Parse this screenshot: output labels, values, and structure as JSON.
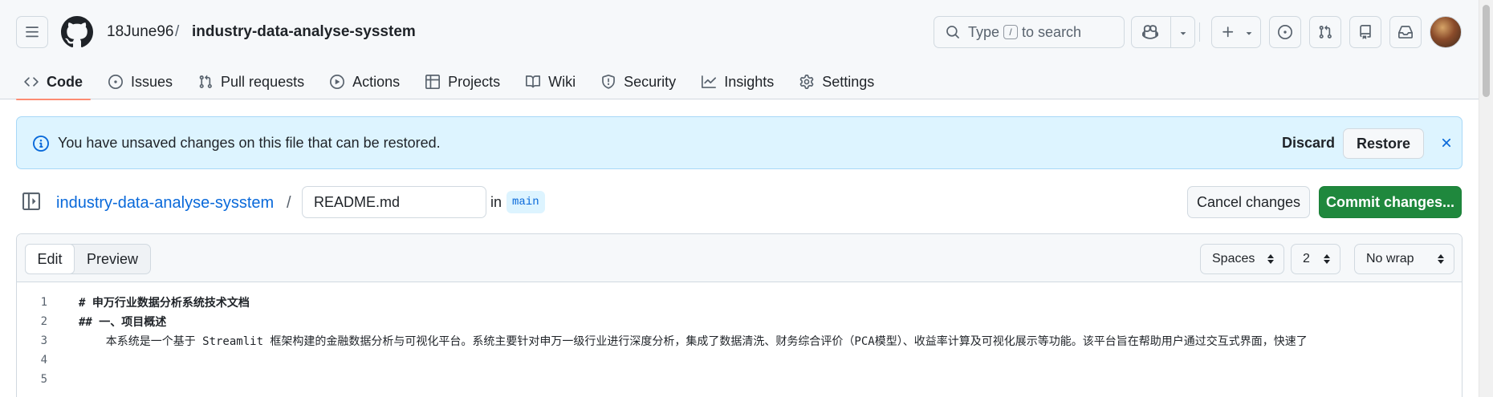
{
  "header": {
    "owner": "18June96",
    "separator": "/",
    "repo": "industry-data-analyse-sysstem",
    "search": {
      "before": "Type",
      "key": "/",
      "after": "to search"
    }
  },
  "nav": {
    "tabs": [
      {
        "label": "Code",
        "icon": "code-icon",
        "active": true
      },
      {
        "label": "Issues",
        "icon": "issue-icon"
      },
      {
        "label": "Pull requests",
        "icon": "pull-request-icon"
      },
      {
        "label": "Actions",
        "icon": "play-icon"
      },
      {
        "label": "Projects",
        "icon": "table-icon"
      },
      {
        "label": "Wiki",
        "icon": "book-icon"
      },
      {
        "label": "Security",
        "icon": "shield-icon"
      },
      {
        "label": "Insights",
        "icon": "graph-icon"
      },
      {
        "label": "Settings",
        "icon": "gear-icon"
      }
    ]
  },
  "flash": {
    "message": "You have unsaved changes on this file that can be restored.",
    "discard": "Discard",
    "restore": "Restore"
  },
  "file": {
    "repo": "industry-data-analyse-sysstem",
    "separator": "/",
    "name": "README.md",
    "in_label": "in",
    "branch": "main",
    "cancel": "Cancel changes",
    "commit": "Commit changes..."
  },
  "editor": {
    "edit_tab": "Edit",
    "preview_tab": "Preview",
    "indent_mode": "Spaces",
    "indent_size": "2",
    "wrap_mode": "No wrap",
    "lines": [
      {
        "n": "1",
        "text": "# 申万行业数据分析系统技术文档"
      },
      {
        "n": "2",
        "text": "## 一、项目概述"
      },
      {
        "n": "3",
        "text": "    本系统是一个基于 Streamlit 框架构建的金融数据分析与可视化平台。系统主要针对申万一级行业进行深度分析，集成了数据清洗、财务综合评价（PCA模型）、收益率计算及可视化展示等功能。该平台旨在帮助用户通过交互式界面，快速了"
      },
      {
        "n": "4",
        "text": ""
      },
      {
        "n": "5",
        "text": ""
      }
    ]
  },
  "colors": {
    "accent_blue": "#0969da",
    "commit_green": "#1f883d",
    "flash_bg": "#ddf4ff",
    "active_tab_underline": "#fd8c73"
  }
}
